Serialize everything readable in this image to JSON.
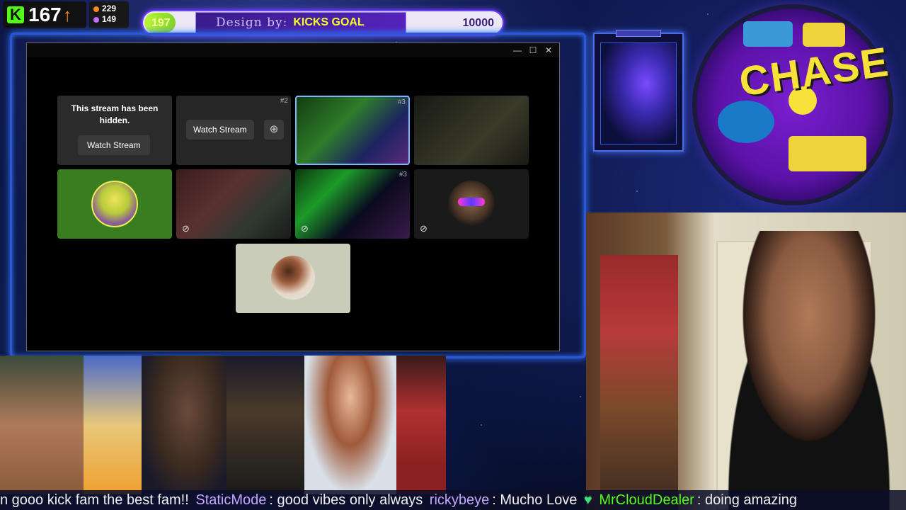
{
  "kick_counter": {
    "value": "167",
    "arrow": "↑"
  },
  "stats": {
    "line1": "229",
    "line2": "149",
    "color1": "#ff8a1c",
    "color2": "#c06cff"
  },
  "goal": {
    "current": "197",
    "design_label": "Design by:",
    "label": "KICKS GOAL",
    "target": "10000",
    "progress_fraction": 0.0197
  },
  "window_controls": {
    "minimize": "—",
    "maximize": "☐",
    "close": "✕"
  },
  "tiles": {
    "hidden": {
      "message": "This stream has been hidden.",
      "button": "Watch Stream"
    },
    "watch": {
      "button": "Watch Stream",
      "number": "#2"
    },
    "stream1": {
      "number": "#3"
    },
    "stream4": {
      "number": "#3"
    }
  },
  "chase": {
    "text": "CHASE"
  },
  "ticker": {
    "segments": [
      {
        "text": "n gooo kick fam the best fam!!",
        "style": "plain"
      },
      {
        "text": "StaticMode",
        "style": "purple"
      },
      {
        "text": ": good vibes only always",
        "style": "plain"
      },
      {
        "text": "rickybeye",
        "style": "purple"
      },
      {
        "text": ": Mucho Love",
        "style": "plain"
      },
      {
        "text": "MrCloudDealer",
        "style": "green"
      },
      {
        "text": ": doing amazing",
        "style": "plain"
      }
    ]
  }
}
